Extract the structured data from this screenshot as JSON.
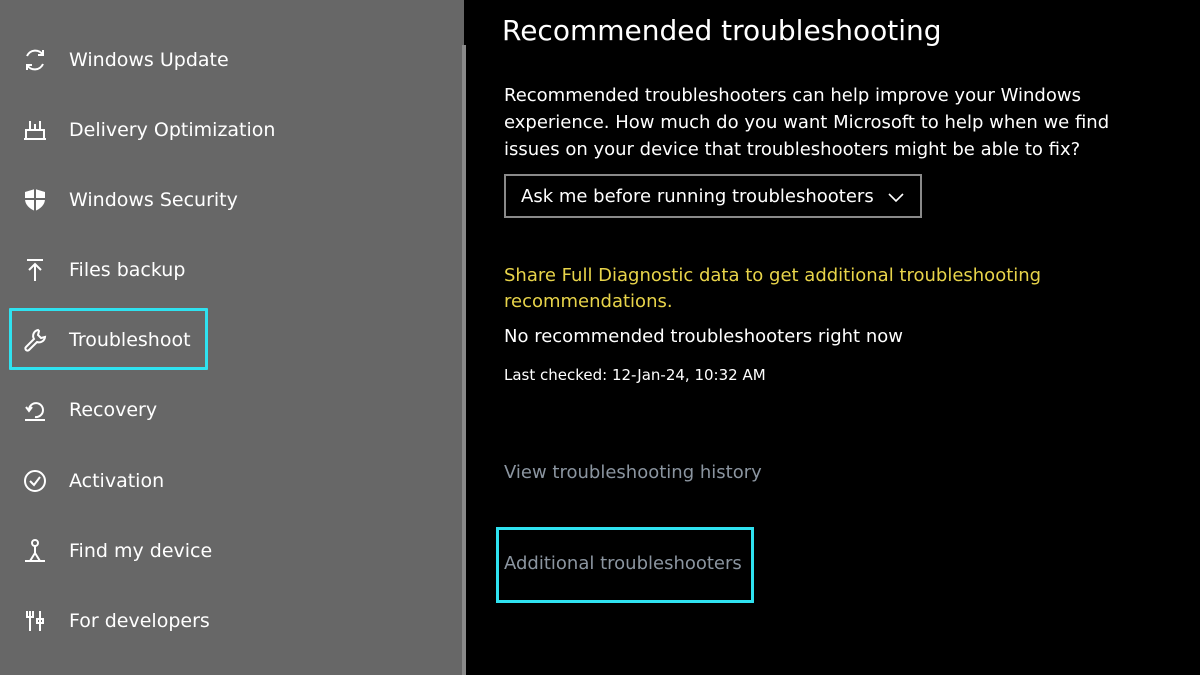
{
  "sidebar": {
    "items": [
      {
        "label": "Windows Update",
        "icon": "refresh-icon"
      },
      {
        "label": "Delivery Optimization",
        "icon": "delivery-icon"
      },
      {
        "label": "Windows Security",
        "icon": "shield-icon"
      },
      {
        "label": "Files backup",
        "icon": "upload-arrow-icon"
      },
      {
        "label": "Troubleshoot",
        "icon": "wrench-icon",
        "selected": true
      },
      {
        "label": "Recovery",
        "icon": "recovery-icon"
      },
      {
        "label": "Activation",
        "icon": "check-circle-icon"
      },
      {
        "label": "Find my device",
        "icon": "person-location-icon"
      },
      {
        "label": "For developers",
        "icon": "tools-icon"
      }
    ]
  },
  "main": {
    "title": "Recommended troubleshooting",
    "description": "Recommended troubleshooters can help improve your Windows experience. How much do you want Microsoft to help when we find issues on your device that troubleshooters might be able to fix?",
    "dropdown": {
      "selected": "Ask me before running troubleshooters"
    },
    "share_link": "Share Full Diagnostic data to get additional troubleshooting recommendations.",
    "no_recommended": "No recommended troubleshooters right now",
    "last_checked": "Last checked: 12-Jan-24, 10:32 AM",
    "history_link": "View troubleshooting history",
    "additional_link": "Additional troubleshooters"
  },
  "colors": {
    "sidebar_bg": "#676767",
    "highlight": "#2fe2f0",
    "link_yellow": "#e8d44a",
    "link_gray": "#8b95a0"
  }
}
